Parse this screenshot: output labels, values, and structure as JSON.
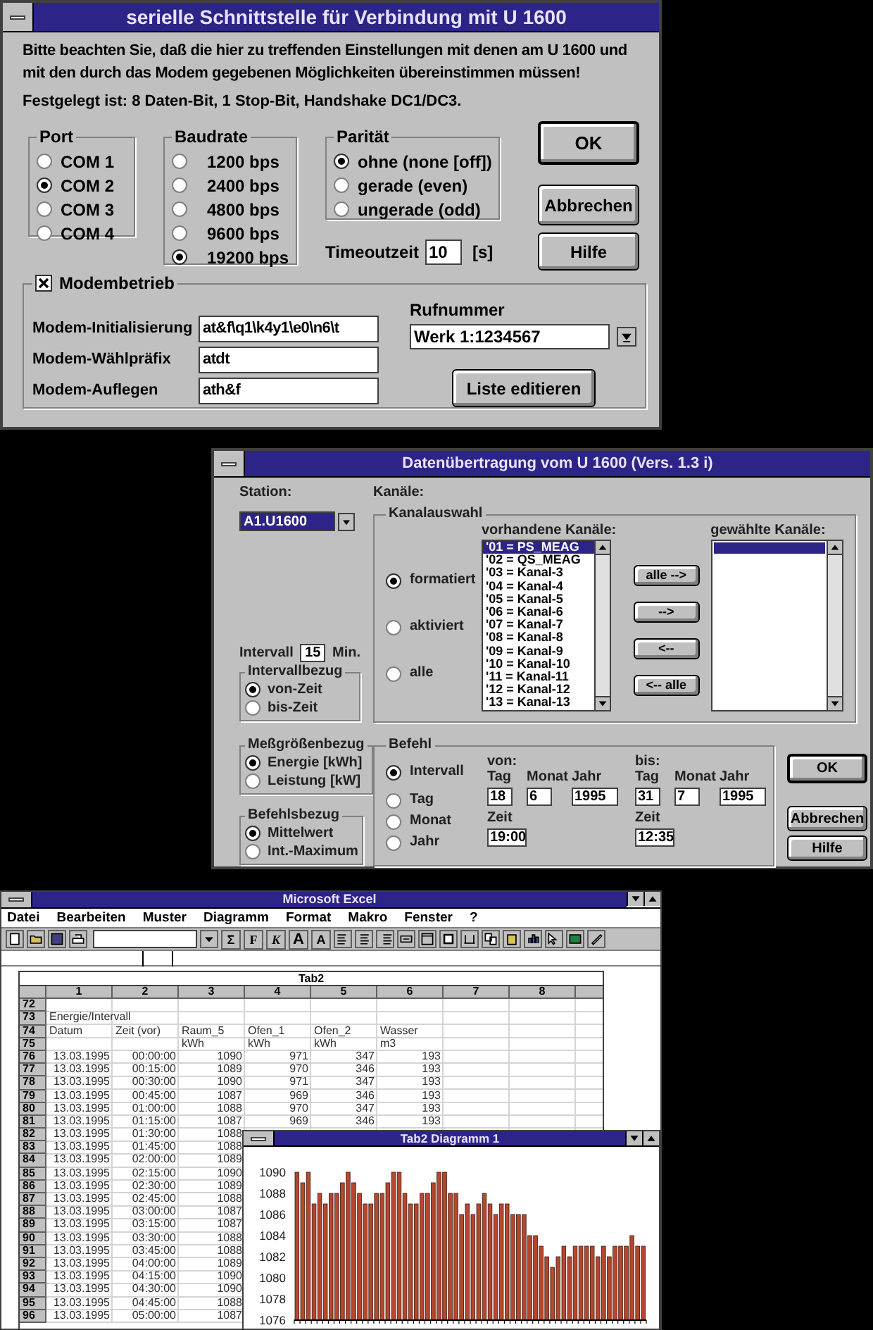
{
  "serial_dialog": {
    "title": "serielle Schnittstelle für Verbindung mit U 1600",
    "notice": "Bitte beachten Sie, daß die hier zu treffenden Einstellungen mit denen am U 1600 und mit den durch das Modem gegebenen Möglichkeiten übereinstimmen müssen!",
    "fixed": "Festgelegt ist: 8 Daten-Bit, 1 Stop-Bit, Handshake DC1/DC3.",
    "groups": [
      {
        "label": "Port",
        "options": [
          {
            "label": "COM 1",
            "selected": false
          },
          {
            "label": "COM 2",
            "selected": true
          },
          {
            "label": "COM 3",
            "selected": false
          },
          {
            "label": "COM 4",
            "selected": false
          }
        ]
      },
      {
        "label": "Baudrate",
        "options": [
          {
            "label": "1200 bps",
            "selected": false
          },
          {
            "label": "2400 bps",
            "selected": false
          },
          {
            "label": "4800 bps",
            "selected": false
          },
          {
            "label": "9600 bps",
            "selected": false
          },
          {
            "label": "19200 bps",
            "selected": true
          }
        ]
      },
      {
        "label": "Parität",
        "options": [
          {
            "label": "ohne (none [off])",
            "selected": true
          },
          {
            "label": "gerade (even)",
            "selected": false
          },
          {
            "label": "ungerade (odd)",
            "selected": false
          }
        ]
      }
    ],
    "timeout": {
      "label": "Timeoutzeit",
      "value": "10",
      "unit": "[s]"
    },
    "buttons": [
      {
        "label": "OK",
        "default": true
      },
      {
        "label": "Abbrechen",
        "default": false
      },
      {
        "label": "Hilfe",
        "default": false
      }
    ],
    "modem": {
      "label": "Modembetrieb",
      "checked": true,
      "fields": [
        {
          "label": "Modem-Initialisierung",
          "value": "at&f\\q1\\k4y1\\e0\\n6\\t"
        },
        {
          "label": "Modem-Wählpräfix",
          "value": "atdt"
        },
        {
          "label": "Modem-Auflegen",
          "value": "ath&f"
        }
      ],
      "phone": {
        "label": "Rufnummer",
        "value": "Werk 1:1234567"
      },
      "edit_button": "Liste editieren"
    }
  },
  "transfer_dialog": {
    "title": "Datenübertragung vom U 1600  (Vers. 1.3 i)",
    "station": {
      "label": "Station:",
      "value": "A1.U1600"
    },
    "channels_label": "Kanäle:",
    "channel_select": {
      "label": "Kanalauswahl",
      "options": [
        {
          "label": "formatiert",
          "selected": true
        },
        {
          "label": "aktiviert",
          "selected": false
        },
        {
          "label": "alle",
          "selected": false
        }
      ],
      "available": {
        "label": "vorhandene Kanäle:",
        "items": [
          {
            "label": "'01 = PS_MEAG",
            "selected": true
          },
          {
            "label": "'02 = QS_MEAG",
            "selected": false
          },
          {
            "label": "'03 = Kanal-3",
            "selected": false
          },
          {
            "label": "'04 = Kanal-4",
            "selected": false
          },
          {
            "label": "'05 = Kanal-5",
            "selected": false
          },
          {
            "label": "'06 = Kanal-6",
            "selected": false
          },
          {
            "label": "'07 = Kanal-7",
            "selected": false
          },
          {
            "label": "'08 = Kanal-8",
            "selected": false
          },
          {
            "label": "'09 = Kanal-9",
            "selected": false
          },
          {
            "label": "'10 = Kanal-10",
            "selected": false
          },
          {
            "label": "'11 = Kanal-11",
            "selected": false
          },
          {
            "label": "'12 = Kanal-12",
            "selected": false
          },
          {
            "label": "'13 = Kanal-13",
            "selected": false
          }
        ]
      },
      "move_buttons": [
        "alle -->",
        "-->",
        "<--",
        "<-- alle"
      ],
      "chosen": {
        "label": "gewählte Kanäle:",
        "highlight": true
      }
    },
    "interval": {
      "label": "Intervall",
      "value": "15",
      "unit": "Min."
    },
    "side_groups": [
      {
        "label": "Intervallbezug",
        "options": [
          {
            "label": "von-Zeit",
            "selected": true
          },
          {
            "label": "bis-Zeit",
            "selected": false
          }
        ]
      },
      {
        "label": "Meßgrößenbezug",
        "options": [
          {
            "label": "Energie [kWh]",
            "selected": true
          },
          {
            "label": "Leistung [kW]",
            "selected": false
          }
        ]
      },
      {
        "label": "Befehlsbezug",
        "options": [
          {
            "label": "Mittelwert",
            "selected": true
          },
          {
            "label": "Int.-Maximum",
            "selected": false
          }
        ]
      }
    ],
    "command": {
      "label": "Befehl",
      "options": [
        {
          "label": "Intervall",
          "selected": true
        },
        {
          "label": "Tag",
          "selected": false
        },
        {
          "label": "Monat",
          "selected": false
        },
        {
          "label": "Jahr",
          "selected": false
        }
      ],
      "ranges": [
        {
          "label": "von:",
          "date": [
            {
              "label": "Tag",
              "value": "18"
            },
            {
              "label": "Monat",
              "value": "6"
            },
            {
              "label": "Jahr",
              "value": "1995"
            }
          ],
          "time": {
            "label": "Zeit",
            "value": "19:00"
          }
        },
        {
          "label": "bis:",
          "date": [
            {
              "label": "Tag",
              "value": "31"
            },
            {
              "label": "Monat",
              "value": "7"
            },
            {
              "label": "Jahr",
              "value": "1995"
            }
          ],
          "time": {
            "label": "Zeit",
            "value": "12:35"
          }
        }
      ]
    },
    "buttons": [
      {
        "label": "OK",
        "default": true
      },
      {
        "label": "Abbrechen",
        "default": false
      },
      {
        "label": "Hilfe",
        "default": false
      }
    ]
  },
  "excel": {
    "title": "Microsoft Excel",
    "menu": [
      "Datei",
      "Bearbeiten",
      "Muster",
      "Diagramm",
      "Format",
      "Makro",
      "Fenster",
      "?"
    ],
    "toolbar_text": [
      "Σ",
      "F",
      "K",
      "A",
      "A"
    ],
    "sheet": {
      "title": "Tab2",
      "columns": [
        "1",
        "2",
        "3",
        "4",
        "5",
        "6",
        "7",
        "8"
      ],
      "rows": [
        {
          "header": "72",
          "kind": "text"
        },
        {
          "header": "73",
          "kind": "text",
          "cells": [
            "Energie/Intervall"
          ]
        },
        {
          "header": "74",
          "kind": "text",
          "cells": [
            "Datum",
            "Zeit (vor)",
            "Raum_5",
            "Ofen_1",
            "Ofen_2",
            "Wasser"
          ]
        },
        {
          "header": "75",
          "kind": "text",
          "cells": [
            null,
            null,
            "kWh",
            "kWh",
            "kWh",
            "m3"
          ]
        },
        {
          "header": "76",
          "kind": "data",
          "cells": [
            "13.03.1995",
            "00:00:00",
            "1090",
            "971",
            "347",
            "193"
          ]
        },
        {
          "header": "77",
          "kind": "data",
          "cells": [
            "13.03.1995",
            "00:15:00",
            "1089",
            "970",
            "346",
            "193"
          ]
        },
        {
          "header": "78",
          "kind": "data",
          "cells": [
            "13.03.1995",
            "00:30:00",
            "1090",
            "971",
            "347",
            "193"
          ]
        },
        {
          "header": "79",
          "kind": "data",
          "cells": [
            "13.03.1995",
            "00:45:00",
            "1087",
            "969",
            "346",
            "193"
          ]
        },
        {
          "header": "80",
          "kind": "data",
          "cells": [
            "13.03.1995",
            "01:00:00",
            "1088",
            "970",
            "347",
            "193"
          ]
        },
        {
          "header": "81",
          "kind": "data",
          "cells": [
            "13.03.1995",
            "01:15:00",
            "1087",
            "969",
            "346",
            "193"
          ]
        },
        {
          "header": "82",
          "kind": "data",
          "cells": [
            "13.03.1995",
            "01:30:00",
            "1088"
          ]
        },
        {
          "header": "83",
          "kind": "data",
          "cells": [
            "13.03.1995",
            "01:45:00",
            "1088"
          ]
        },
        {
          "header": "84",
          "kind": "data",
          "cells": [
            "13.03.1995",
            "02:00:00",
            "1089"
          ]
        },
        {
          "header": "85",
          "kind": "data",
          "cells": [
            "13.03.1995",
            "02:15:00",
            "1090"
          ]
        },
        {
          "header": "86",
          "kind": "data",
          "cells": [
            "13.03.1995",
            "02:30:00",
            "1089"
          ]
        },
        {
          "header": "87",
          "kind": "data",
          "cells": [
            "13.03.1995",
            "02:45:00",
            "1088"
          ]
        },
        {
          "header": "88",
          "kind": "data",
          "cells": [
            "13.03.1995",
            "03:00:00",
            "1087"
          ]
        },
        {
          "header": "89",
          "kind": "data",
          "cells": [
            "13.03.1995",
            "03:15:00",
            "1087"
          ]
        },
        {
          "header": "90",
          "kind": "data",
          "cells": [
            "13.03.1995",
            "03:30:00",
            "1088"
          ]
        },
        {
          "header": "91",
          "kind": "data",
          "cells": [
            "13.03.1995",
            "03:45:00",
            "1088"
          ]
        },
        {
          "header": "92",
          "kind": "data",
          "cells": [
            "13.03.1995",
            "04:00:00",
            "1089"
          ]
        },
        {
          "header": "93",
          "kind": "data",
          "cells": [
            "13.03.1995",
            "04:15:00",
            "1090"
          ]
        },
        {
          "header": "94",
          "kind": "data",
          "cells": [
            "13.03.1995",
            "04:30:00",
            "1090"
          ]
        },
        {
          "header": "95",
          "kind": "data",
          "cells": [
            "13.03.1995",
            "04:45:00",
            "1088"
          ]
        },
        {
          "header": "96",
          "kind": "data",
          "cells": [
            "13.03.1995",
            "05:00:00",
            "1087"
          ]
        }
      ]
    },
    "chart_window": {
      "title": "Tab2 Diagramm 1",
      "chart_data": {
        "type": "bar",
        "ylim": [
          1076,
          1090
        ],
        "yticks": [
          1076,
          1078,
          1080,
          1082,
          1084,
          1086,
          1088,
          1090
        ],
        "series": [
          {
            "color": "#b5472f",
            "values": [
              1090,
              1089,
              1090,
              1087,
              1088,
              1087,
              1088,
              1088,
              1089,
              1090,
              1089,
              1088,
              1087,
              1087,
              1088,
              1088,
              1089,
              1090,
              1090,
              1088,
              1087,
              1087,
              1088,
              1088,
              1089,
              1090,
              1090,
              1088,
              1088,
              1086,
              1087,
              1086,
              1087,
              1088,
              1087,
              1086,
              1087,
              1087,
              1086,
              1086,
              1086,
              1084,
              1084,
              1083,
              1082,
              1081,
              1082,
              1083,
              1082,
              1083,
              1083,
              1083,
              1083,
              1082,
              1083,
              1082,
              1083,
              1083,
              1083,
              1084,
              1083,
              1083
            ]
          }
        ]
      }
    }
  }
}
